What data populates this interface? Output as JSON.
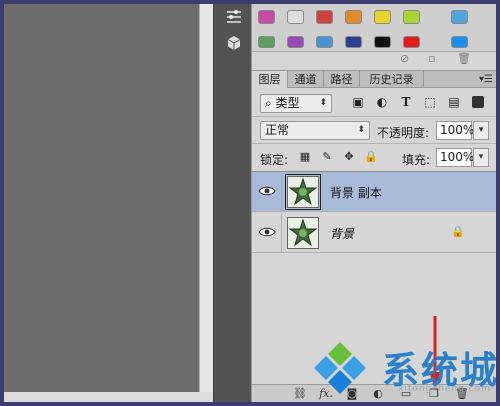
{
  "tabs": [
    {
      "label": "图层",
      "active": true
    },
    {
      "label": "通道",
      "active": false
    },
    {
      "label": "路径",
      "active": false
    },
    {
      "label": "历史记录",
      "active": false
    }
  ],
  "filter": {
    "kind_label": "类型"
  },
  "blend": {
    "mode": "正常",
    "opacity_label": "不透明度:",
    "opacity_value": "100%"
  },
  "lock": {
    "label": "锁定:",
    "fill_label": "填充:",
    "fill_value": "100%"
  },
  "layers": [
    {
      "name": "背景 副本",
      "selected": true,
      "visible": true,
      "locked": false
    },
    {
      "name": "背景",
      "selected": false,
      "visible": true,
      "locked": true
    }
  ],
  "bottom_icons": [
    "link-icon",
    "fx-icon",
    "mask-icon",
    "adjustment-icon",
    "folder-icon",
    "new-layer-icon",
    "trash-icon"
  ],
  "bottom_fx_label": "fx.",
  "swatch_colors": [
    "#b03a8c",
    "#d0d0d0",
    "#c23a3a",
    "#d8801f",
    "#e6d51c",
    "#a8d32a",
    "#4aa3d9",
    "#5a9a5a",
    "#8e3fa8",
    "#3f8fcf",
    "#2a3a8f",
    "#111111",
    "#e11818",
    "#1a8ff0"
  ],
  "watermark": {
    "text": "系统城",
    "url": "xitongcheng.com",
    "colors": {
      "blue": "#2c7fc9",
      "green": "#6abf3a",
      "sky": "#3aa0e6"
    }
  },
  "accent": {
    "selection": "#a9bad9",
    "annotation_arrow": "#e01e1e"
  }
}
